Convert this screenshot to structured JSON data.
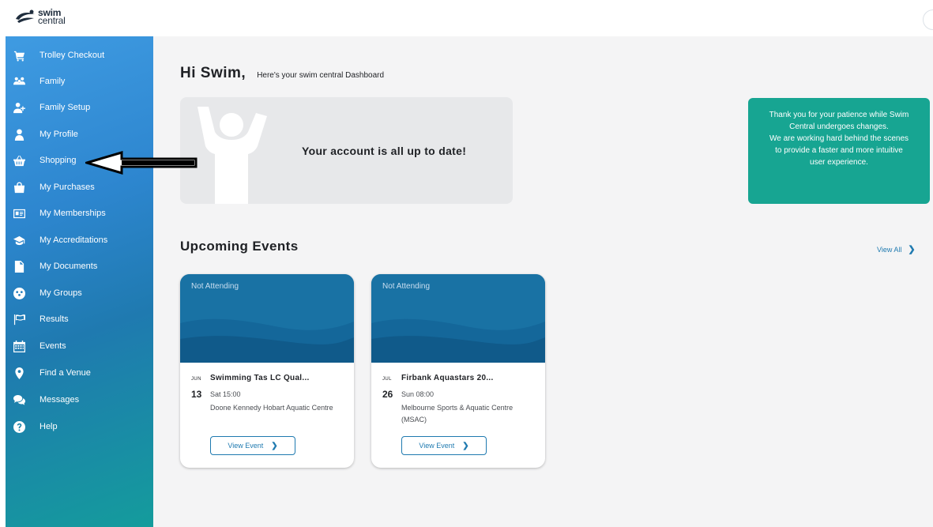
{
  "header": {
    "logo_line1": "swim",
    "logo_line2": "central"
  },
  "sidebar": {
    "items": [
      {
        "label": "Trolley Checkout",
        "icon": "cart-icon"
      },
      {
        "label": "Family",
        "icon": "family-icon"
      },
      {
        "label": "Family Setup",
        "icon": "user-plus-icon"
      },
      {
        "label": "My Profile",
        "icon": "user-icon"
      },
      {
        "label": "Shopping",
        "icon": "basket-icon"
      },
      {
        "label": "My Purchases",
        "icon": "bag-icon"
      },
      {
        "label": "My Memberships",
        "icon": "id-card-icon"
      },
      {
        "label": "My Accreditations",
        "icon": "graduation-cap-icon"
      },
      {
        "label": "My Documents",
        "icon": "document-icon"
      },
      {
        "label": "My Groups",
        "icon": "group-icon"
      },
      {
        "label": "Results",
        "icon": "flag-icon"
      },
      {
        "label": "Events",
        "icon": "calendar-icon"
      },
      {
        "label": "Find a Venue",
        "icon": "map-pin-icon"
      },
      {
        "label": "Messages",
        "icon": "chat-icon"
      },
      {
        "label": "Help",
        "icon": "help-icon"
      }
    ]
  },
  "dashboard": {
    "greeting": "Hi Swim,",
    "subtitle": "Here's your swim central Dashboard",
    "status_message": "Your account is all up to date!",
    "notice_lines": [
      "Thank you for your patience while Swim",
      "Central undergoes changes.",
      "We are working hard behind the scenes",
      "to provide a faster and more intuitive",
      "user experience."
    ]
  },
  "events": {
    "section_title": "Upcoming Events",
    "view_all_label": "View All",
    "cards": [
      {
        "status": "Not Attending",
        "month": "JUN",
        "day": "13",
        "title": "Swimming Tas LC Qual...",
        "when": "Sat 15:00",
        "venue": "Doone Kennedy Hobart Aquatic Centre",
        "button_label": "View Event"
      },
      {
        "status": "Not Attending",
        "month": "JUL",
        "day": "26",
        "title": "Firbank Aquastars 20...",
        "when": "Sun 08:00",
        "venue": "Melbourne Sports & Aquatic Centre (MSAC)",
        "button_label": "View Event"
      }
    ]
  },
  "colors": {
    "sidebar_top": "#3f9be2",
    "sidebar_bottom": "#149c9c",
    "notice_bg": "#17a592",
    "card_banner": "#1972a4",
    "link": "#1f7ab0"
  }
}
